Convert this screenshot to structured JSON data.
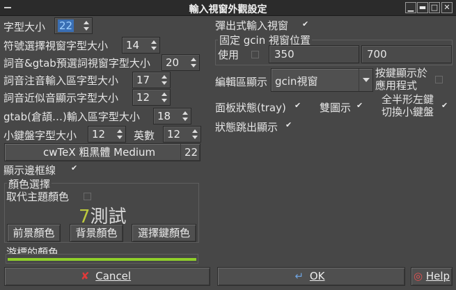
{
  "window": {
    "title": "輸入視窗外觀設定"
  },
  "left": {
    "font_size": {
      "label": "字型大小",
      "value": "22"
    },
    "symbol_font": {
      "label": "符號選擇視窗字型大小",
      "value": "14"
    },
    "gtab_pre_font": {
      "label": "詞音&gtab預選詞視窗字型大小",
      "value": "20"
    },
    "zhuyin_font": {
      "label": "詞音注音輸入區字型大小",
      "value": "17"
    },
    "approx_font": {
      "label": "詞音近似音顯示字型大小",
      "value": "12"
    },
    "gtab_input_font": {
      "label": "gtab(倉頡…)輸入區字型大小",
      "value": "18"
    },
    "keypad_font": {
      "label": "小鍵盤字型大小",
      "value": "12"
    },
    "english": {
      "label": "英數",
      "value": "12"
    },
    "font_button": {
      "name": "cwTeX 粗黑體 Medium",
      "size": "22"
    },
    "show_border": {
      "label": "顯示邊框線",
      "checked": true
    }
  },
  "color_group": {
    "title": "顏色選擇",
    "replace_theme": {
      "label": "取代主題顏色",
      "checked": false
    },
    "preview_num": "7",
    "preview_text": "測試",
    "fg_button": "前景顏色",
    "bg_button": "背景顏色",
    "sel_button": "選擇鍵顏色"
  },
  "cursor": {
    "label": "游標的顏色",
    "progress": 1.0
  },
  "right": {
    "popup": {
      "label": "彈出式輸入視窗",
      "checked": true
    },
    "fixed_group": {
      "title": "固定 gcin 視窗位置",
      "use_label": "使用",
      "use_checked": false,
      "x": "350",
      "y": "700"
    },
    "edit_display": {
      "label": "編輯區顯示",
      "value": "gcin視窗"
    },
    "key_display": {
      "line1": "按鍵顯示於",
      "line2": "應用程式",
      "checked": false
    },
    "tray": {
      "label": "面板狀態(tray)",
      "checked": true
    },
    "dual_icon": {
      "label": "雙圖示",
      "checked": true
    },
    "fullhalf": {
      "line1": "全半形左鍵",
      "line2": "切換小鍵盤",
      "checked": true
    },
    "status_popup": {
      "label": "狀態跳出顯示",
      "checked": true
    }
  },
  "buttons": {
    "cancel": "Cancel",
    "ok": "OK",
    "help": "Help"
  },
  "colors": {
    "bg": "#474747",
    "accent": "#3a6fb4",
    "progress": "#8fcf2a",
    "preview_num": "#bcc93d"
  }
}
